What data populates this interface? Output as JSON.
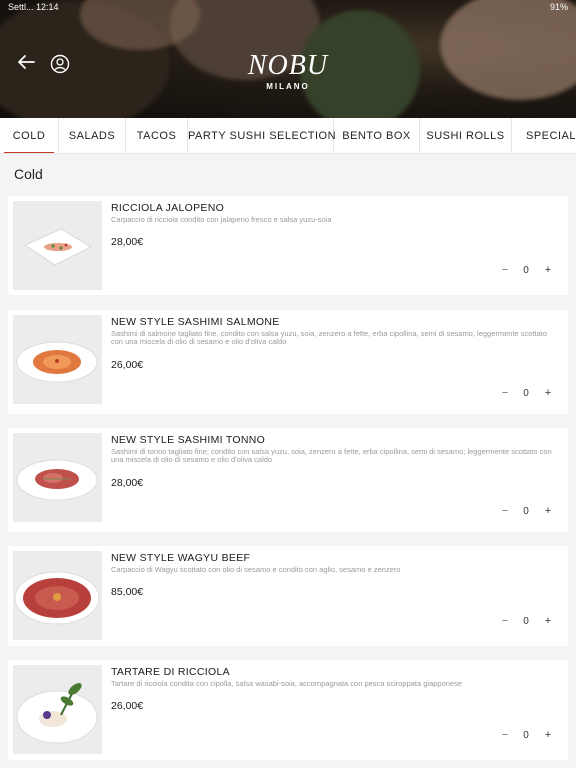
{
  "status_bar": {
    "left": "Settl... 12:14",
    "right": "91%"
  },
  "logo": {
    "name": "NOBU",
    "sub": "MILANO"
  },
  "icons": {
    "back": "arrow-left-icon",
    "profile": "user-circle-icon"
  },
  "tabs": [
    {
      "label": "COLD",
      "active": true
    },
    {
      "label": "SALADS",
      "active": false
    },
    {
      "label": "TACOS",
      "active": false
    },
    {
      "label": "PARTY SUSHI SELECTION",
      "active": false
    },
    {
      "label": "BENTO BOX",
      "active": false
    },
    {
      "label": "SUSHI ROLLS",
      "active": false
    },
    {
      "label": "SPECIAL SU",
      "active": false
    }
  ],
  "section": {
    "title": "Cold"
  },
  "items": [
    {
      "name": "RICCIOLA JALOPENO",
      "description": "Carpaccio di ricciola condito con jalapeno fresco e salsa yuzu-soia",
      "price": "28,00€",
      "quantity": "0",
      "minus": "−",
      "plus": "+"
    },
    {
      "name": "NEW STYLE SASHIMI SALMONE",
      "description": "Sashimi di salmone tagliato fine, condito con salsa yuzu, soia, zenzero a fette, erba cipollina, semi di sesamo; leggermente scottato con una miscela di olio di sesamo e olio d'oliva caldo",
      "price": "26,00€",
      "quantity": "0",
      "minus": "−",
      "plus": "+"
    },
    {
      "name": "NEW STYLE SASHIMI TONNO",
      "description": "Sashimi di tonno tagliato fine, condito con salsa yuzu, soia, zenzero a fette, erba cipollina, semi di sesamo; leggermente scottato con una miscela di olio di sesamo e olio d'oliva caldo",
      "price": "28,00€",
      "quantity": "0",
      "minus": "−",
      "plus": "+"
    },
    {
      "name": "NEW STYLE WAGYU BEEF",
      "description": "Carpaccio di Wagyu scottato con olio di sesamo e condito con aglio, sesamo e zenzero",
      "price": "85,00€",
      "quantity": "0",
      "minus": "−",
      "plus": "+"
    },
    {
      "name": "TARTARE DI RICCIOLA",
      "description": "Tartare di ricciola condita con cipolla, salsa wasabi-soia, accompagnata con pesca sciroppata giapponese",
      "price": "26,00€",
      "quantity": "0",
      "minus": "−",
      "plus": "+"
    }
  ],
  "colors": {
    "accent": "#c0392b",
    "background": "#f4f4f4",
    "card": "#ffffff"
  }
}
